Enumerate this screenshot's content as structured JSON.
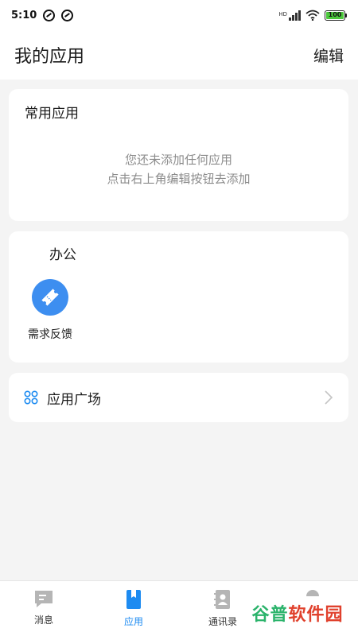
{
  "status_bar": {
    "time": "5:10",
    "network_label": "HD",
    "battery_level": "100",
    "notification_icons": [
      "notification-app-icon",
      "notification-app-icon"
    ]
  },
  "header": {
    "title": "我的应用",
    "edit_label": "编辑"
  },
  "frequent_apps": {
    "title": "常用应用",
    "empty_hint_line1": "您还未添加任何应用",
    "empty_hint_line2": "点击右上角编辑按钮去添加"
  },
  "office": {
    "title": "办公",
    "apps": [
      {
        "label": "需求反馈",
        "icon": "ticket-icon",
        "color": "#3d8ef0"
      }
    ]
  },
  "app_store": {
    "label": "应用广场",
    "icon": "grid-icon",
    "accent": "#1d8bf1"
  },
  "bottom_nav": {
    "items": [
      {
        "label": "消息",
        "icon": "message-icon",
        "active": false
      },
      {
        "label": "应用",
        "icon": "apps-icon",
        "active": true
      },
      {
        "label": "通讯录",
        "icon": "contacts-icon",
        "active": false
      },
      {
        "label": "",
        "icon": "profile-icon",
        "active": false
      }
    ],
    "active_color": "#1d8bf1",
    "inactive_color": "#b5b5b5"
  },
  "watermark": {
    "text_part1": "谷普",
    "text_part2": "软件园"
  }
}
